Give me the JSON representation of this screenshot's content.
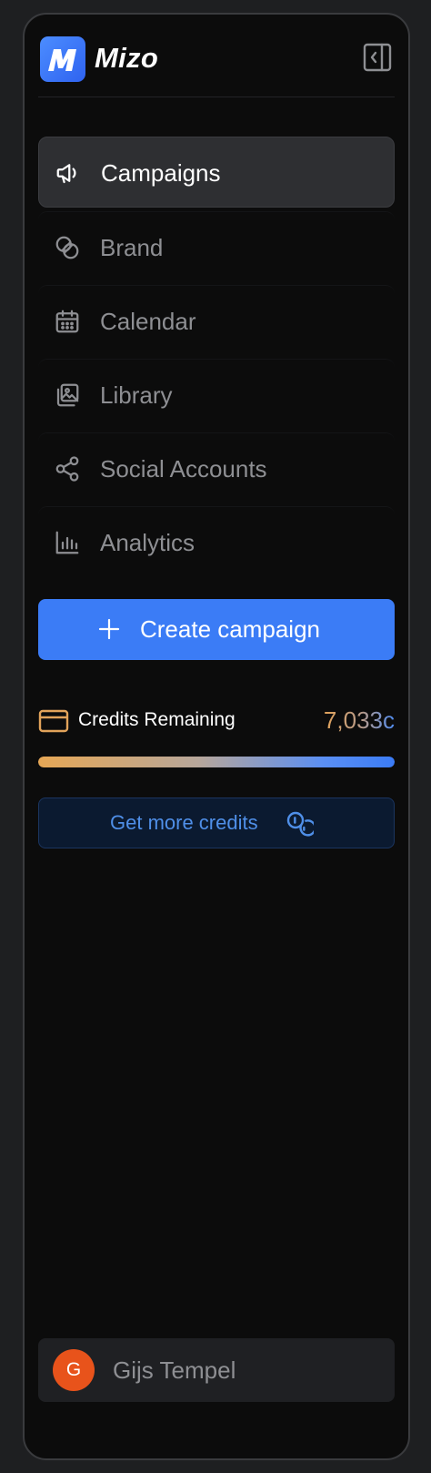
{
  "brand": {
    "name": "Mizo",
    "accent": "#3b7cf6"
  },
  "header": {
    "collapse_icon": "sidebar-collapse-icon"
  },
  "nav": {
    "items": [
      {
        "label": "Campaigns",
        "icon": "megaphone-icon",
        "active": true
      },
      {
        "label": "Brand",
        "icon": "overlapping-circles-icon",
        "active": false
      },
      {
        "label": "Calendar",
        "icon": "calendar-icon",
        "active": false
      },
      {
        "label": "Library",
        "icon": "image-stack-icon",
        "active": false
      },
      {
        "label": "Social Accounts",
        "icon": "share-icon",
        "active": false
      },
      {
        "label": "Analytics",
        "icon": "bar-chart-icon",
        "active": false
      }
    ]
  },
  "create_button": {
    "label": "Create campaign",
    "icon": "plus-icon"
  },
  "credits": {
    "label": "Credits Remaining",
    "value": "7,033c",
    "icon": "credit-card-icon",
    "progress": 1.0
  },
  "more_credits_button": {
    "label": "Get more credits",
    "icon": "coins-icon"
  },
  "user": {
    "initial": "G",
    "name": "Gijs Tempel",
    "avatar_color": "#e8531b"
  }
}
